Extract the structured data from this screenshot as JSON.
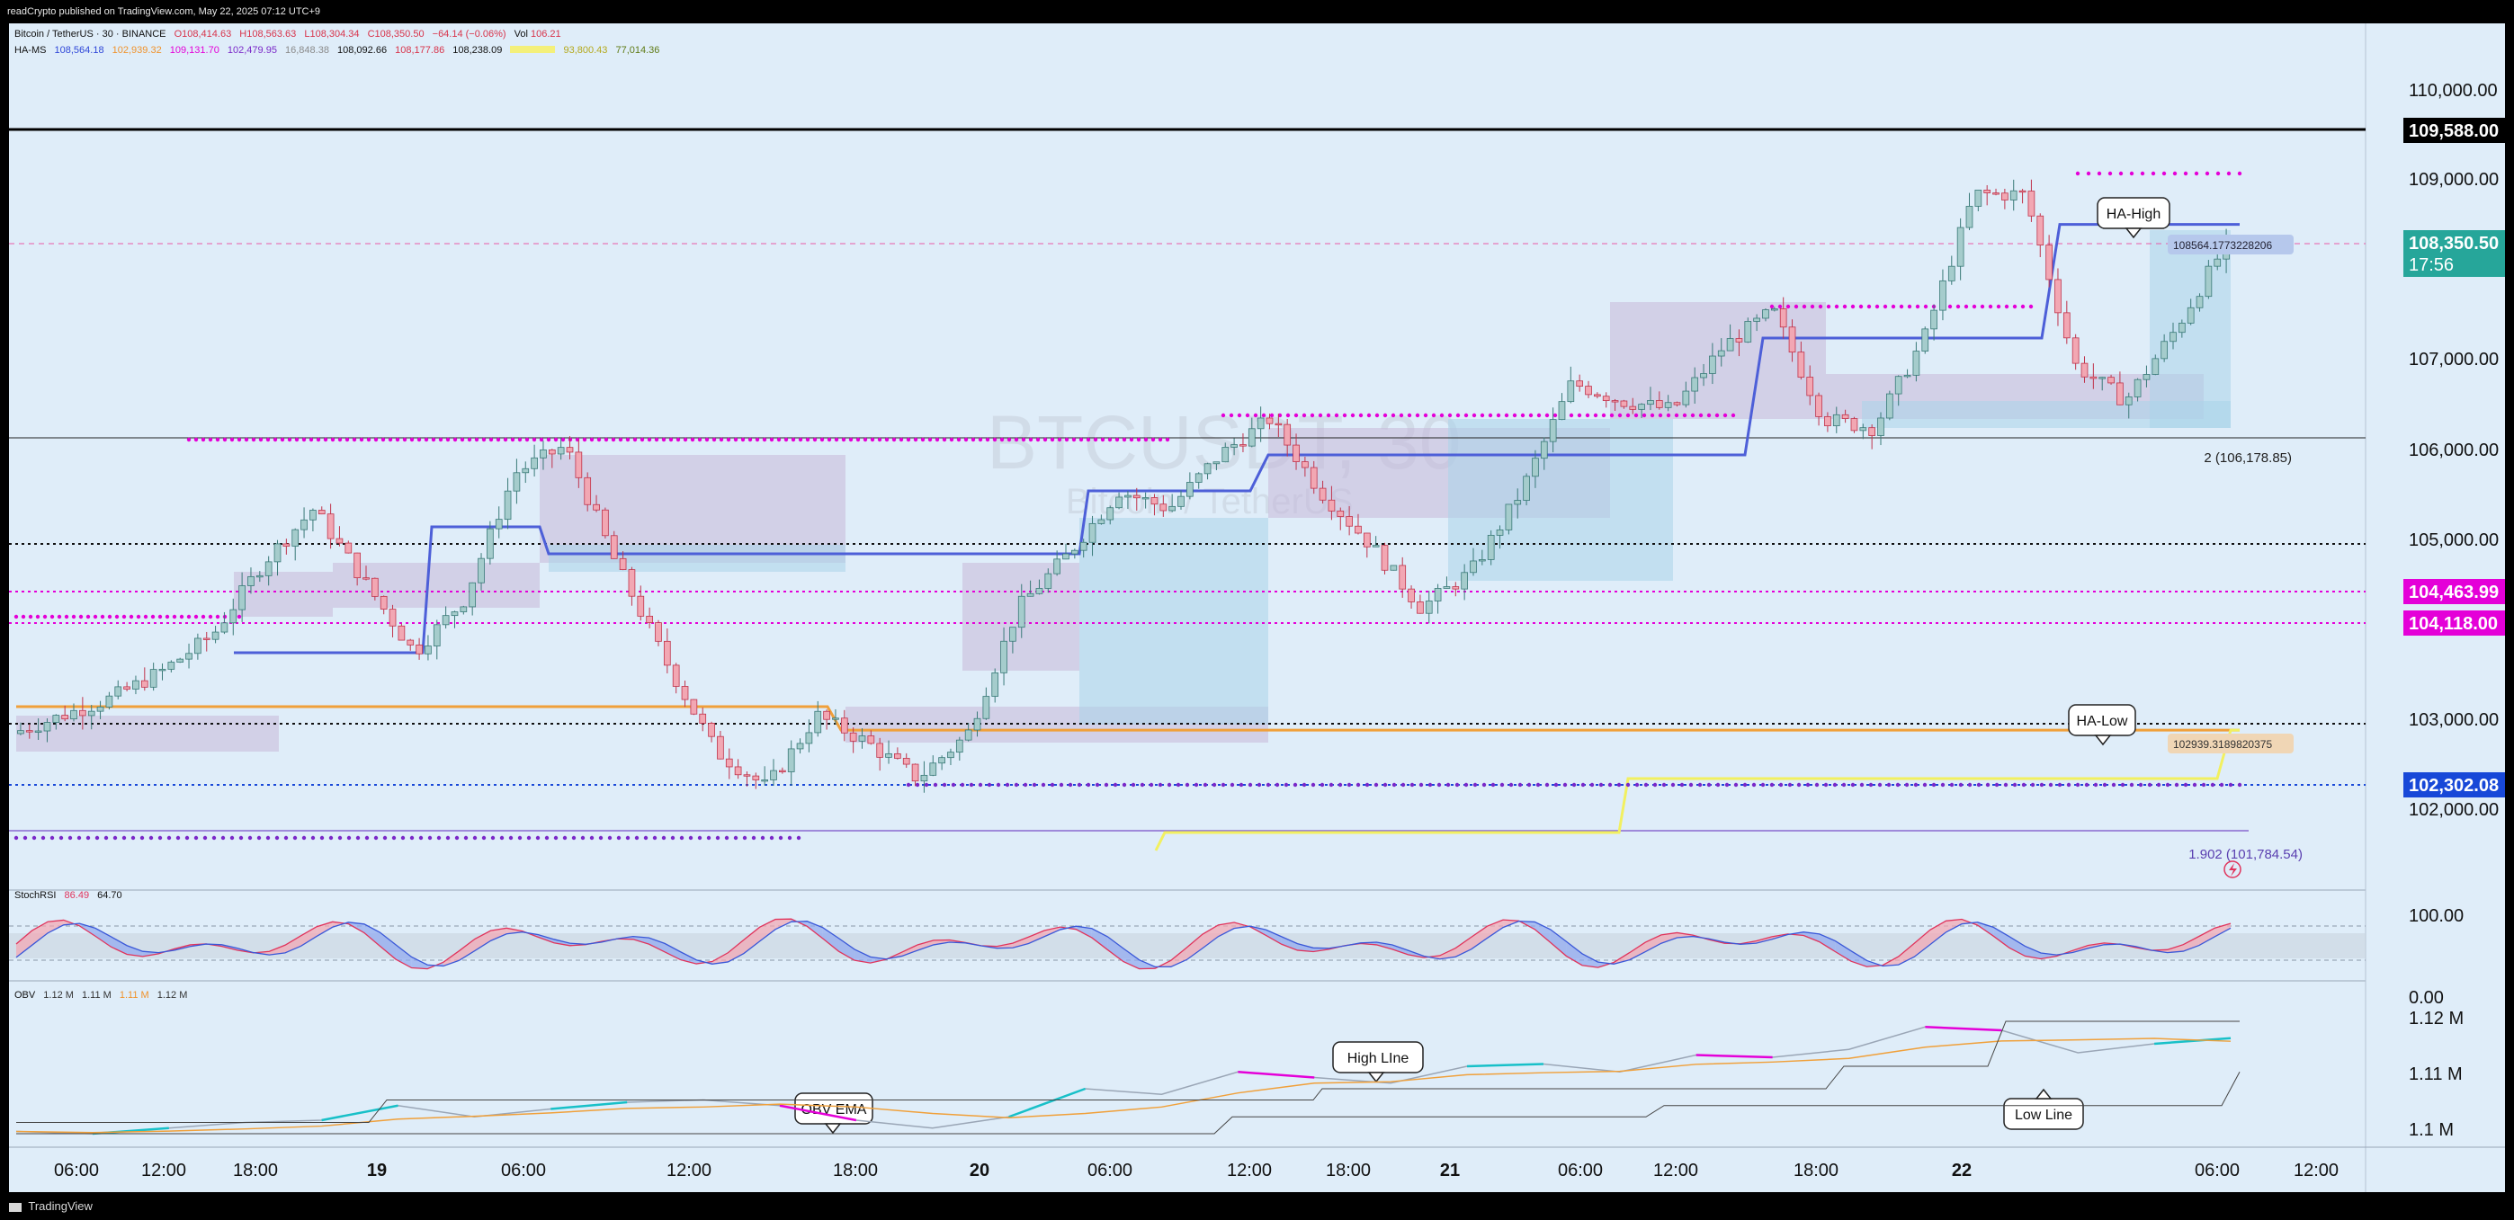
{
  "header": {
    "published": "readCrypto published on TradingView.com, May 22, 2025 07:12 UTC+9"
  },
  "legend_main": {
    "symbol": "Bitcoin / TetherUS · 30 · BINANCE",
    "o": "O108,414.63",
    "h": "H108,563.63",
    "l": "L108,304.34",
    "c": "C108,350.50",
    "chg": "−64.14 (−0.06%)",
    "vol_label": "Vol",
    "vol": "106.21"
  },
  "legend_hams": {
    "name": "HA-MS",
    "v1": "108,564.18",
    "v2": "102,939.32",
    "v3": "109,131.70",
    "v4": "102,479.95",
    "v5": "16,848.38",
    "v6": "108,092.66",
    "v7": "108,177.86",
    "v8": "108,238.09",
    "v9": "",
    "v10": "93,800.43",
    "v11": "77,014.36"
  },
  "legend_stoch": {
    "name": "StochRSI",
    "k": "86.49",
    "d": "64.70"
  },
  "legend_obv": {
    "name": "OBV",
    "v1": "1.12 M",
    "v2": "1.11 M",
    "v3": "1.11 M",
    "v4": "1.12 M"
  },
  "watermark": {
    "ticker": "BTCUSDT, 30",
    "name": "Bitcoin / TetherUS"
  },
  "price_axis": {
    "labels": [
      "110,000.00",
      "109,000.00",
      "107,000.00",
      "106,000.00",
      "105,000.00",
      "103,000.00",
      "102,000.00"
    ],
    "badges": {
      "resistance": "109,588.00",
      "current": "108,350.50",
      "countdown": "17:56",
      "magenta1": "104,463.99",
      "magenta2": "104,118.00",
      "support": "102,302.08"
    }
  },
  "stoch_axis": {
    "top": "100.00",
    "bottom": "0.00"
  },
  "obv_axis": {
    "l1": "1.12 M",
    "l2": "1.11 M",
    "l3": "1.1 M"
  },
  "annotations": {
    "ha_high": "HA-High",
    "ha_low": "HA-Low",
    "obv_ema": "OBV EMA",
    "high_line": "High LIne",
    "low_line": "Low Line",
    "fib_2": "2 (106,178.85)",
    "fib_1902": "1.902 (101,784.54)",
    "ha_high_value": "108564.1773228206",
    "ha_low_value": "102939.3189820375"
  },
  "time_axis": {
    "labels": [
      "06:00",
      "12:00",
      "18:00",
      "19",
      "06:00",
      "12:00",
      "18:00",
      "20",
      "06:00",
      "12:00",
      "18:00",
      "21",
      "06:00",
      "12:00",
      "18:00",
      "22",
      "06:00",
      "12:00"
    ]
  },
  "footer": {
    "brand": "TradingView"
  },
  "colors": {
    "background": "#dfedf9",
    "up_candle": "#8fbfbf",
    "down_candle": "#e58f9c",
    "ha_high_line": "#4d5fd8",
    "ha_low_line": "#f0a03a",
    "magenta": "#e400d8",
    "support_badge": "#1848d8",
    "current_badge": "#26a69a"
  },
  "chart_data": {
    "type": "candlestick",
    "symbol": "BTCUSDT",
    "interval": "30",
    "ylim": [
      101600,
      110600
    ],
    "key_levels": [
      109588.0,
      108564.18,
      108350.5,
      106178.85,
      104463.99,
      104118.0,
      102939.32,
      102302.08,
      101784.54
    ],
    "price_path": [
      102900,
      103100,
      103300,
      103600,
      104000,
      104800,
      105400,
      104600,
      103800,
      104400,
      105800,
      106100,
      104800,
      103700,
      102700,
      102300,
      103100,
      102800,
      102400,
      102900,
      104300,
      104900,
      105600,
      105400,
      106000,
      106400,
      105600,
      105000,
      104300,
      104700,
      105600,
      106800,
      106600,
      106500,
      107200,
      107600,
      106400,
      106300,
      107300,
      108900,
      108900,
      107000,
      106600,
      107400,
      108350
    ],
    "stoch_rsi": {
      "k": "86.49",
      "d": "64.70",
      "ylim": [
        0,
        100
      ]
    },
    "obv": {
      "values": [
        "1.12 M",
        "1.11 M",
        "1.11 M",
        "1.12 M"
      ],
      "ylim": [
        "1.1 M",
        "1.12 M"
      ]
    }
  }
}
